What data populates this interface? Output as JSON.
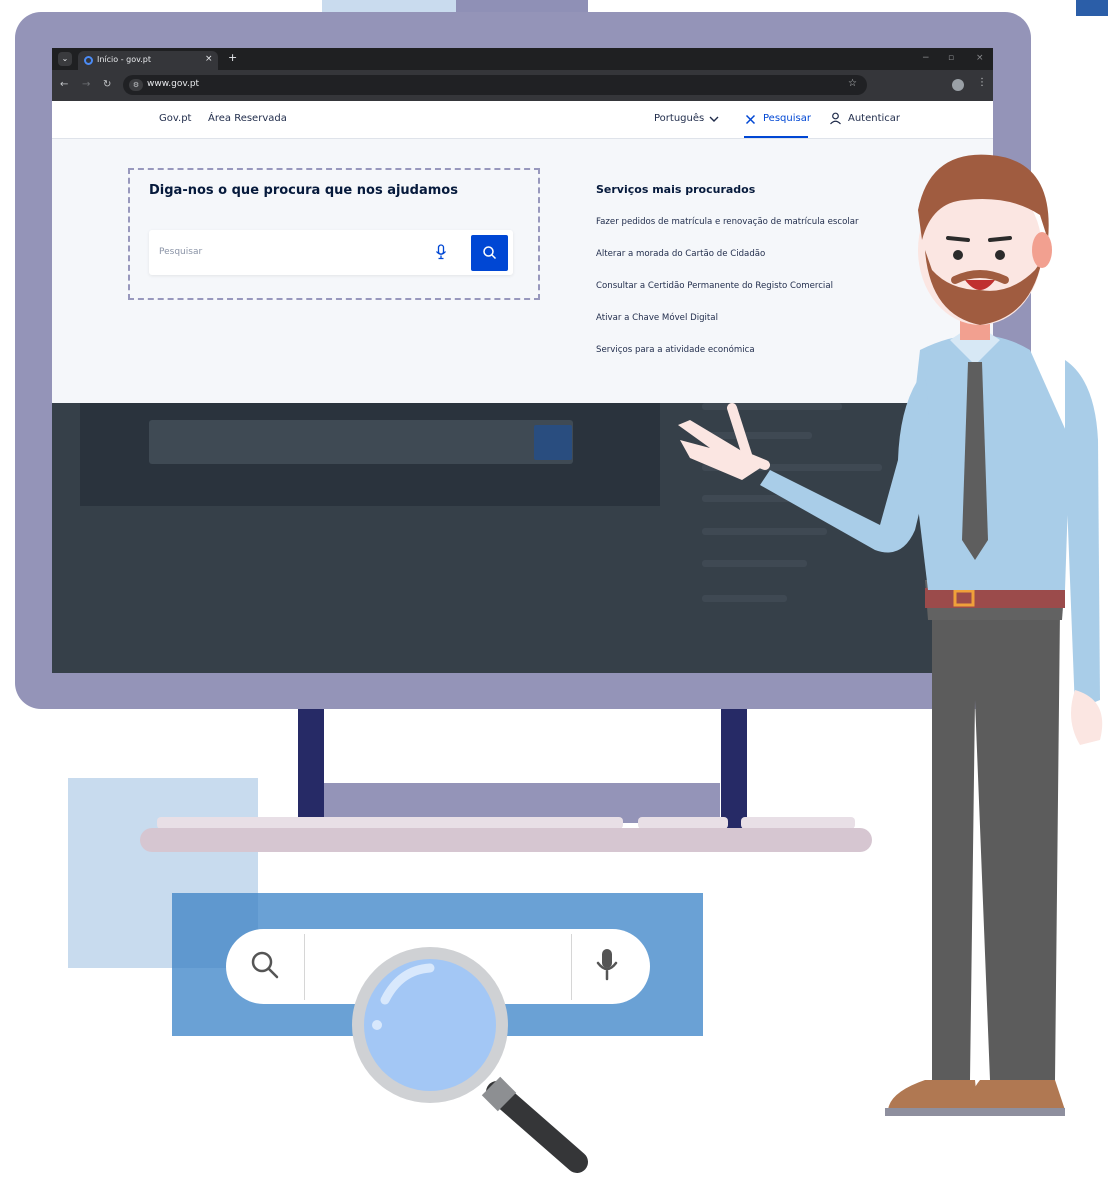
{
  "browser": {
    "tab_title": "Início - gov.pt",
    "tab_close": "×",
    "new_tab": "+",
    "url": "www.gov.pt",
    "minimize": "−",
    "maximize": "▫",
    "close": "×"
  },
  "site_nav": {
    "left_links": [
      "Gov.pt",
      "Área Reservada"
    ],
    "language": "Português",
    "search_label": "Pesquisar",
    "auth_label": "Autenticar"
  },
  "search_panel": {
    "heading": "Diga-nos o que procura que nos ajudamos",
    "placeholder": "Pesquisar"
  },
  "services": {
    "heading": "Serviços mais procurados",
    "items": [
      "Fazer pedidos de matrícula e renovação de matrícula escolar",
      "Alterar a morada do Cartão de Cidadão",
      "Consultar a Certidão Permanente do Registo Comercial",
      "Ativar a Chave Móvel Digital",
      "Serviços para a atividade económica"
    ]
  },
  "colors": {
    "accent": "#0047d4",
    "heading": "#061a3c",
    "monitor_frame": "#9494b8",
    "overlay": "#364049",
    "illustration_blue": "#6aa1d5"
  },
  "icons": [
    "chevron-down-icon",
    "close-icon",
    "user-icon",
    "microphone-icon",
    "search-icon",
    "magnifying-glass-icon"
  ]
}
